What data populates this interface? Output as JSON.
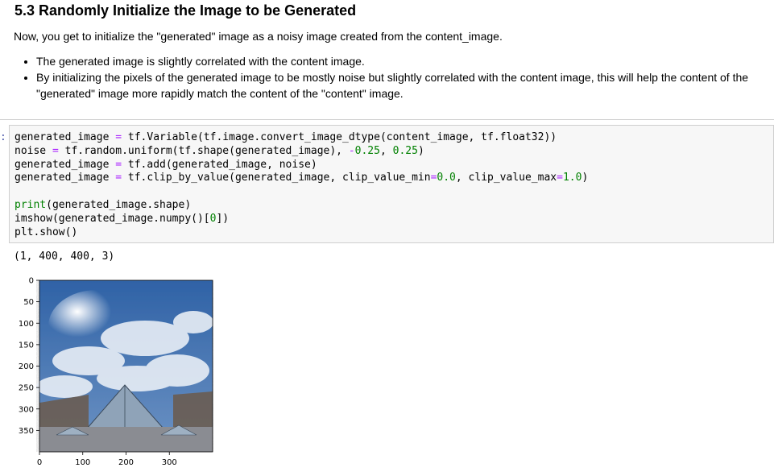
{
  "markdown": {
    "heading": "5.3 Randomly Initialize the Image to be Generated",
    "intro": "Now, you get to initialize the \"generated\" image as a noisy image created from the content_image.",
    "bullets": [
      "The generated image is slightly correlated with the content image.",
      "By initializing the pixels of the generated image to be mostly noise but slightly correlated with the content image, this will help the content of the \"generated\" image more rapidly match the content of the \"content\" image."
    ]
  },
  "cell": {
    "prompt": ":",
    "lines": [
      "generated_image = tf.Variable(tf.image.convert_image_dtype(content_image, tf.float32))",
      "noise = tf.random.uniform(tf.shape(generated_image), -0.25, 0.25)",
      "generated_image = tf.add(generated_image, noise)",
      "generated_image = tf.clip_by_value(generated_image, clip_value_min=0.0, clip_value_max=1.0)",
      "",
      "print(generated_image.shape)",
      "imshow(generated_image.numpy()[0])",
      "plt.show()"
    ],
    "output_text": "(1, 400, 400, 3)"
  },
  "plot": {
    "y_ticks": [
      "0",
      "50",
      "100",
      "150",
      "200",
      "250",
      "300",
      "350"
    ],
    "x_ticks": [
      "0",
      "100",
      "200",
      "300"
    ],
    "image_subject": "noisy-louvre-pyramid-image",
    "colors": {
      "sky": "#3a6fb0",
      "cloud": "#e8eef6",
      "ground": "#8a8c92",
      "building": "#6b5a4a"
    }
  }
}
